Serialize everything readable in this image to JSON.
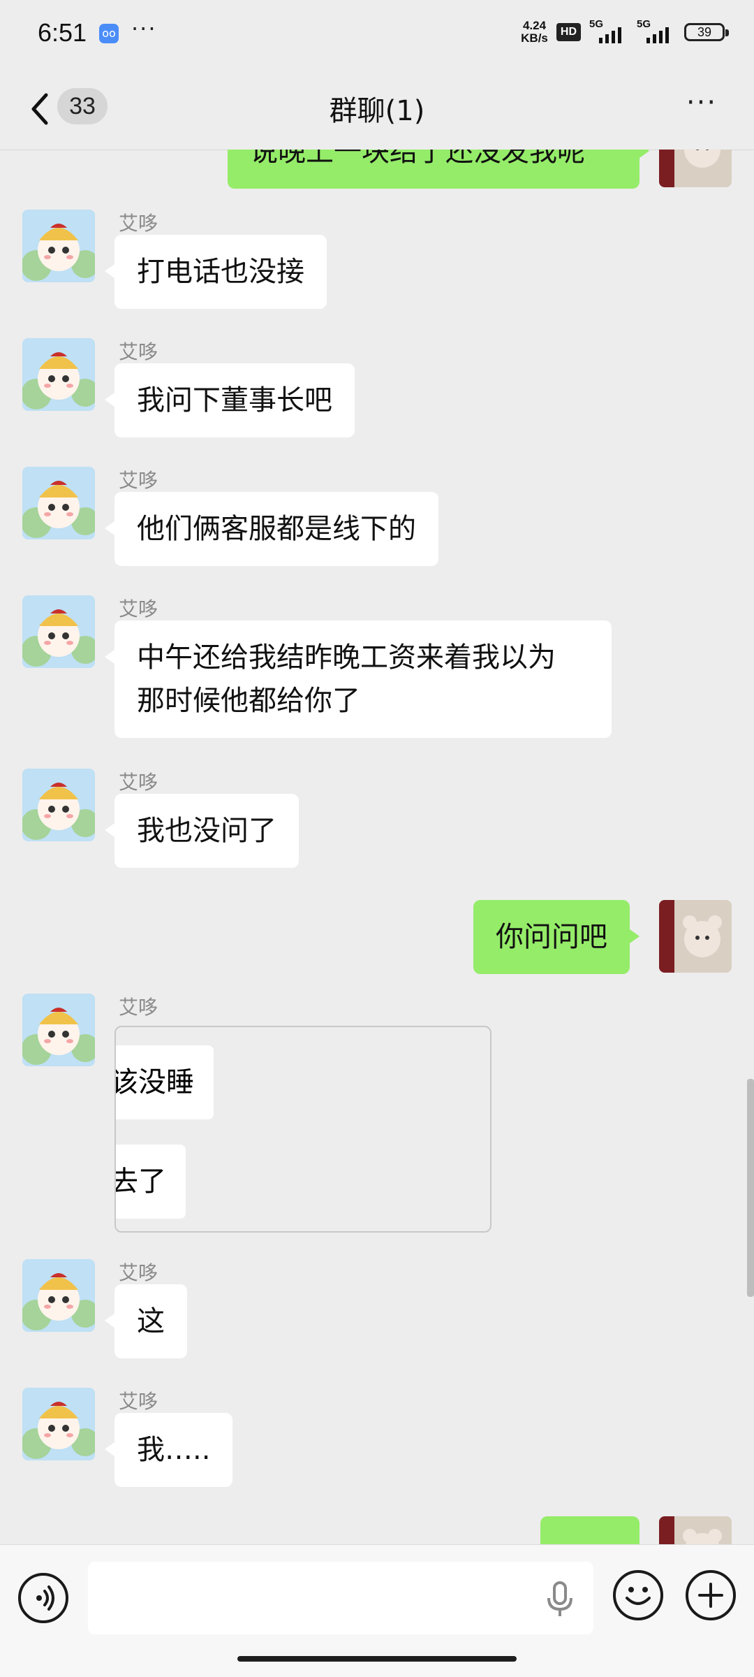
{
  "status_bar": {
    "time": "6:51",
    "app_icon": "oo",
    "dots": "···",
    "speed_value": "4.24",
    "speed_unit": "KB/s",
    "hd_label": "HD",
    "signal1_label": "5G",
    "signal2_label": "5G",
    "battery": "39"
  },
  "header": {
    "unread_count": "33",
    "title": "群聊(1)",
    "more": "···"
  },
  "messages": [
    {
      "side": "right",
      "text": "说晚上一块结了还没发我呢"
    },
    {
      "side": "left",
      "sender": "艾哆",
      "text": "打电话也没接"
    },
    {
      "side": "left",
      "sender": "艾哆",
      "text": "我问下董事长吧"
    },
    {
      "side": "left",
      "sender": "艾哆",
      "text": "他们俩客服都是线下的"
    },
    {
      "side": "left",
      "sender": "艾哆",
      "text_line1": "中午还给我结昨晚工资来着我以为",
      "text_line2": "那时候他都给你了"
    },
    {
      "side": "left",
      "sender": "艾哆",
      "text": "我也没问了"
    },
    {
      "side": "right",
      "text": "你问问吧"
    },
    {
      "side": "left",
      "sender": "艾哆",
      "card_line1": "该没睡",
      "card_line2": "去了"
    },
    {
      "side": "left",
      "sender": "艾哆",
      "text": "这"
    },
    {
      "side": "left",
      "sender": "艾哆",
      "text": "我….."
    }
  ],
  "colors": {
    "background": "#ededed",
    "own_bubble": "#95ec69",
    "other_bubble": "#ffffff"
  },
  "icons": {
    "back": "chevron-left-icon",
    "more": "more-icon",
    "voice": "voice-icon",
    "mic": "mic-icon",
    "emoji": "emoji-icon",
    "plus": "plus-icon"
  }
}
